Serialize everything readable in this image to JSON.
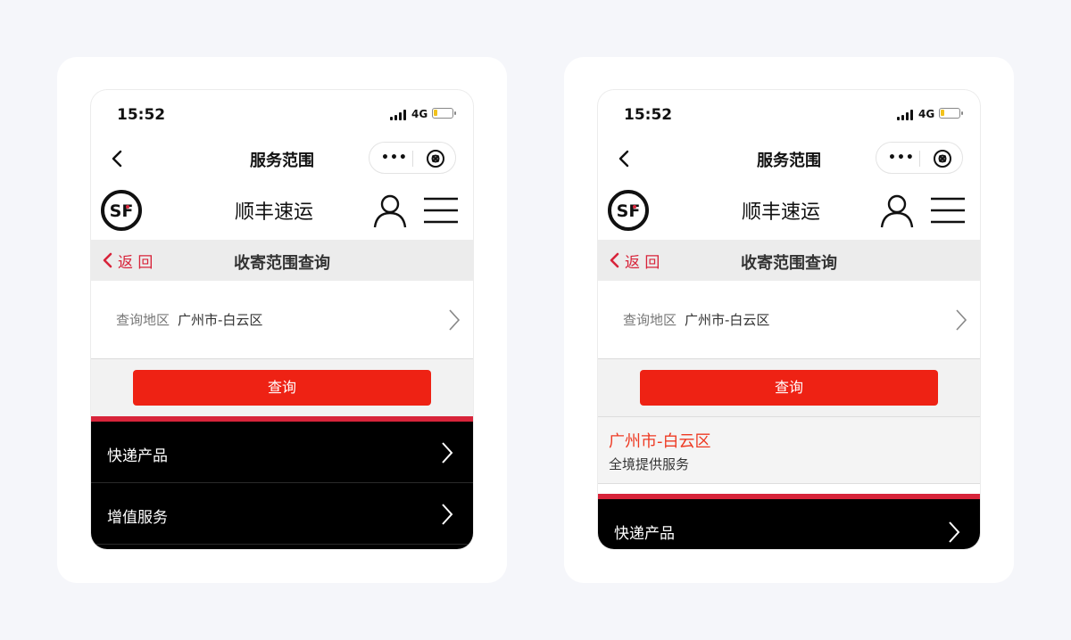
{
  "status_bar": {
    "time": "15:52",
    "network": "4G"
  },
  "navbar": {
    "title": "服务范围",
    "more_label": "•••"
  },
  "brand": {
    "name": "顺丰速运",
    "logo_text": "SF"
  },
  "subheader": {
    "return_label": "返 回",
    "title": "收寄范围查询"
  },
  "query": {
    "label": "查询地区",
    "value": "广州市-白云区",
    "button_label": "查询"
  },
  "result": {
    "city": "广州市-白云区",
    "description": "全境提供服务"
  },
  "menu": {
    "items": [
      {
        "label": "快递产品"
      },
      {
        "label": "增值服务"
      }
    ]
  },
  "colors": {
    "brand_red": "#ee2214",
    "accent_red": "#d8243a",
    "result_orange": "#ee3a23",
    "menu_background": "#000000"
  }
}
